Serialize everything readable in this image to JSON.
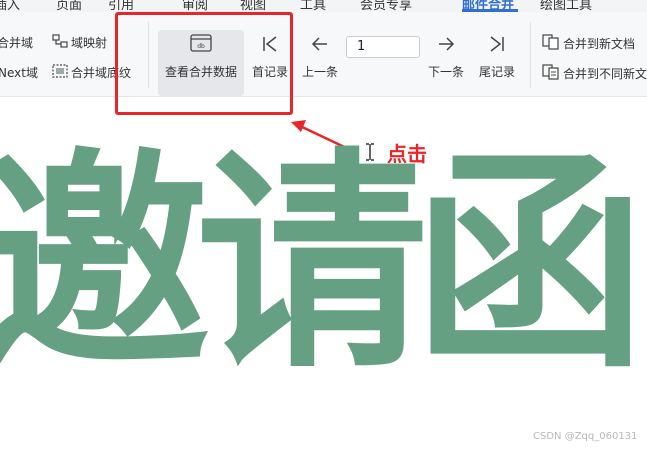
{
  "menu": {
    "items": [
      "插入",
      "页面",
      "引用",
      "审阅",
      "视图",
      "工具",
      "会员专享",
      "邮件合并",
      "绘图工具"
    ],
    "active": "邮件合并"
  },
  "ribbon": {
    "merge_field": "合并域",
    "field_mapping": "域映射",
    "next_field": "Next域",
    "field_shading": "合并域底纹",
    "view_merged_data": "查看合并数据",
    "first_record": "首记录",
    "prev_record": "上一条",
    "record_number": "1",
    "next_record": "下一条",
    "last_record": "尾记录",
    "merge_to_new_doc": "合并到新文档",
    "merge_to_diff_doc": "合并到不同新文"
  },
  "annotation": {
    "click_label": "点击",
    "highlight_color": "#e8262a"
  },
  "document": {
    "title": "邀请函",
    "title_color": "#66a083"
  },
  "watermark": "CSDN @Zqq_060131"
}
